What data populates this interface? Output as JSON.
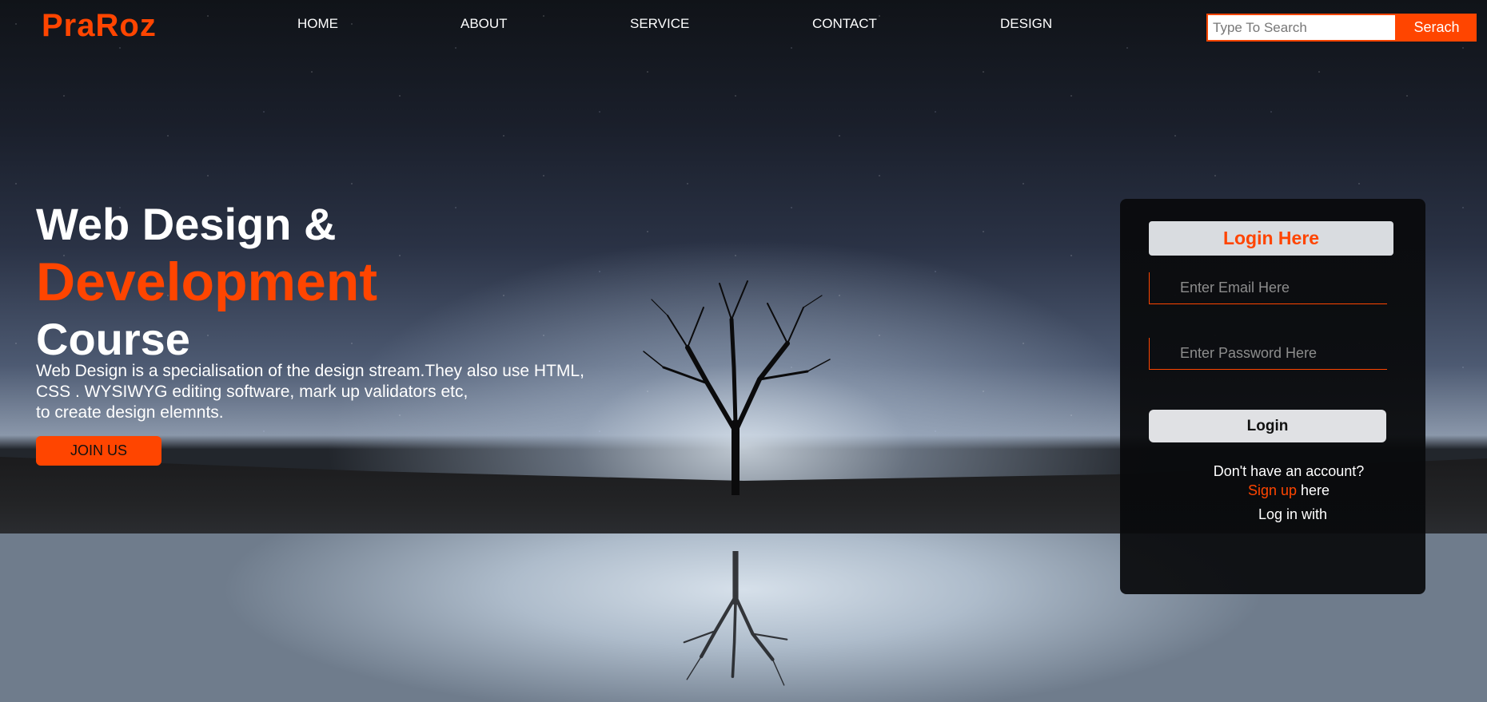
{
  "brand": {
    "name": "PraRoz",
    "accent": "#ff4500"
  },
  "nav": [
    {
      "label": "HOME"
    },
    {
      "label": "ABOUT"
    },
    {
      "label": "SERVICE"
    },
    {
      "label": "CONTACT"
    },
    {
      "label": "DESIGN"
    }
  ],
  "search": {
    "placeholder": "Type To Search",
    "value": "",
    "button_label": "Serach"
  },
  "hero": {
    "title_line1": "Web Design &",
    "title_line2": "Development",
    "title_line3": "Course",
    "description": [
      "Web Design is a specialisation of the design stream.They also use HTML,",
      "CSS . WYSIWYG editing software, mark up validators etc,",
      "to create design elemnts."
    ],
    "cta_label": "JOIN US"
  },
  "login": {
    "title": "Login Here",
    "email_placeholder": "Enter Email Here",
    "password_placeholder": "Enter Password Here",
    "button_label": "Login",
    "no_account_text": "Don't have an account?",
    "signup_link": "Sign up",
    "signup_suffix": " here",
    "login_with_text": "Log in with"
  },
  "icons": {
    "tree": "tree-silhouette-icon"
  }
}
